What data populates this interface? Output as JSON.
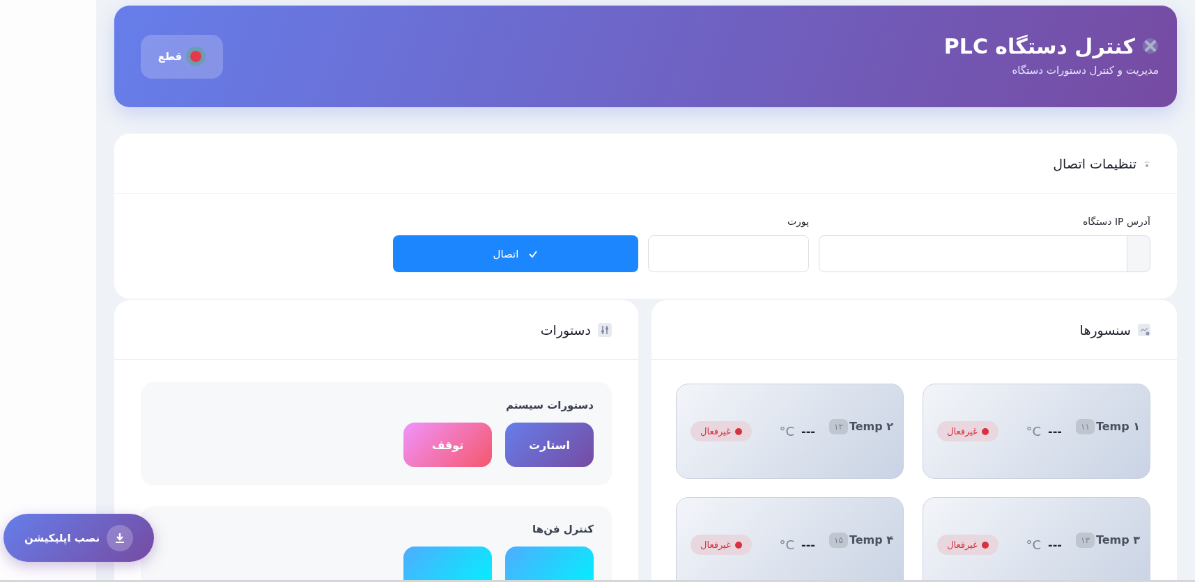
{
  "header": {
    "title": "کنترل دستگاه PLC",
    "subtitle": "مدیریت و کنترل دستورات دستگاه",
    "disconnect_button": {
      "label": "قطع",
      "connected": false
    }
  },
  "connection": {
    "title": "تنظیمات اتصال",
    "ip_label": "آدرس IP دستگاه",
    "port_label": "پورت",
    "connect_button": "اتصال"
  },
  "commands": {
    "title": "دستورات",
    "groups": [
      {
        "title": "دستورات سیستم",
        "buttons": [
          {
            "kind": "start",
            "label": "استارت"
          },
          {
            "kind": "stop",
            "label": "توقف"
          }
        ]
      },
      {
        "title": "کنترل فن‌ها",
        "buttons": [
          {
            "kind": "fan"
          },
          {
            "kind": "fan"
          }
        ]
      }
    ]
  },
  "sensors": {
    "title": "سنسورها",
    "items": [
      {
        "name": "Temp ۱",
        "badge": "۱۱",
        "value": "---",
        "unit": "C°",
        "status": "غیرفعال",
        "active": false
      },
      {
        "name": "Temp ۲",
        "badge": "۱۲",
        "value": "---",
        "unit": "C°",
        "status": "غیرفعال",
        "active": false
      },
      {
        "name": "Temp ۳",
        "badge": "۱۳",
        "value": "---",
        "unit": "C°",
        "status": "غیرفعال",
        "active": false
      },
      {
        "name": "Temp ۴",
        "badge": "۱۵",
        "value": "---",
        "unit": "C°",
        "status": "غیرفعال",
        "active": false
      }
    ]
  },
  "install_button": "نصب اپلیکیشن"
}
